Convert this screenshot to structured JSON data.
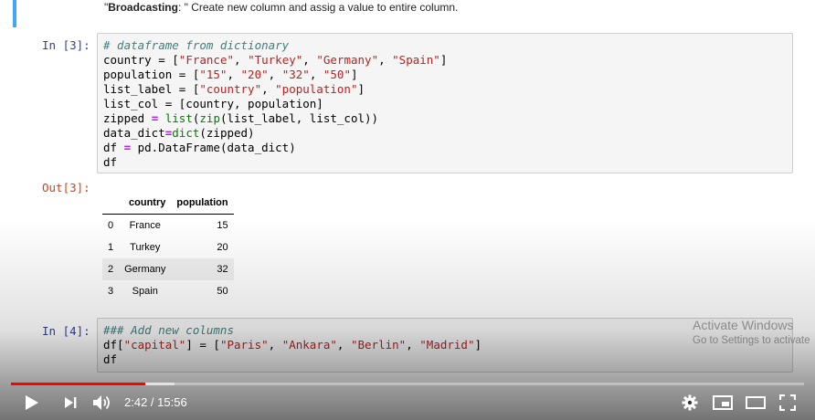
{
  "top_cell": {
    "prefix": "\"",
    "bold": "Broadcasting",
    "rest": ": \" Create new column and assig a value to entire column."
  },
  "cells": {
    "in3_prompt": "In [3]:",
    "in3_lines": {
      "l1": "# dataframe from dictionary",
      "l2a": "country = [",
      "l2b": "\"France\"",
      "l2c": ", ",
      "l2d": "\"Turkey\"",
      "l2e": ", ",
      "l2f": "\"Germany\"",
      "l2g": ", ",
      "l2h": "\"Spain\"",
      "l2i": "]",
      "l3a": "population = [",
      "l3b": "\"15\"",
      "l3c": ", ",
      "l3d": "\"20\"",
      "l3e": ", ",
      "l3f": "\"32\"",
      "l3g": ", ",
      "l3h": "\"50\"",
      "l3i": "]",
      "l4a": "list_label = [",
      "l4b": "\"country\"",
      "l4c": ", ",
      "l4d": "\"population\"",
      "l4e": "]",
      "l5": "list_col = [country, population]",
      "l6a": "zipped ",
      "l6b": "=",
      "l6c": " ",
      "l6d": "list",
      "l6e": "(",
      "l6f": "zip",
      "l6g": "(list_label, list_col))",
      "l7a": "data_dict",
      "l7b": "=",
      "l7c": "dict",
      "l7d": "(zipped)",
      "l8a": "df ",
      "l8b": "=",
      "l8c": " pd.DataFrame(data_dict)",
      "l9": "df"
    },
    "out3_prompt": "Out[3]:",
    "table": {
      "headers": [
        "",
        "country",
        "population"
      ],
      "rows": [
        [
          "0",
          "France",
          "15"
        ],
        [
          "1",
          "Turkey",
          "20"
        ],
        [
          "2",
          "Germany",
          "32"
        ],
        [
          "3",
          "Spain",
          "50"
        ]
      ]
    },
    "in4_prompt": "In [4]:",
    "in4_lines": {
      "l1": "### Add new columns",
      "l2a": "df[",
      "l2b": "\"capital\"",
      "l2c": "] = [",
      "l2d": "\"Paris\"",
      "l2e": ", ",
      "l2f": "\"Ankara\"",
      "l2g": ", ",
      "l2h": "\"Berlin\"",
      "l2i": ", ",
      "l2j": "\"Madrid\"",
      "l2k": "]",
      "l3": "df"
    }
  },
  "watermark": {
    "line1": "Activate Windows",
    "line2": "Go to Settings to activate"
  },
  "player": {
    "current_time": "2:42",
    "separator": " / ",
    "duration": "15:56",
    "played_fraction": 0.1695,
    "buffered_fraction": 0.206,
    "accent_color": "#ff0000",
    "icons": [
      "play-icon",
      "next-icon",
      "volume-icon",
      "settings-gear-icon",
      "miniplayer-icon",
      "theater-mode-icon",
      "fullscreen-icon"
    ]
  }
}
